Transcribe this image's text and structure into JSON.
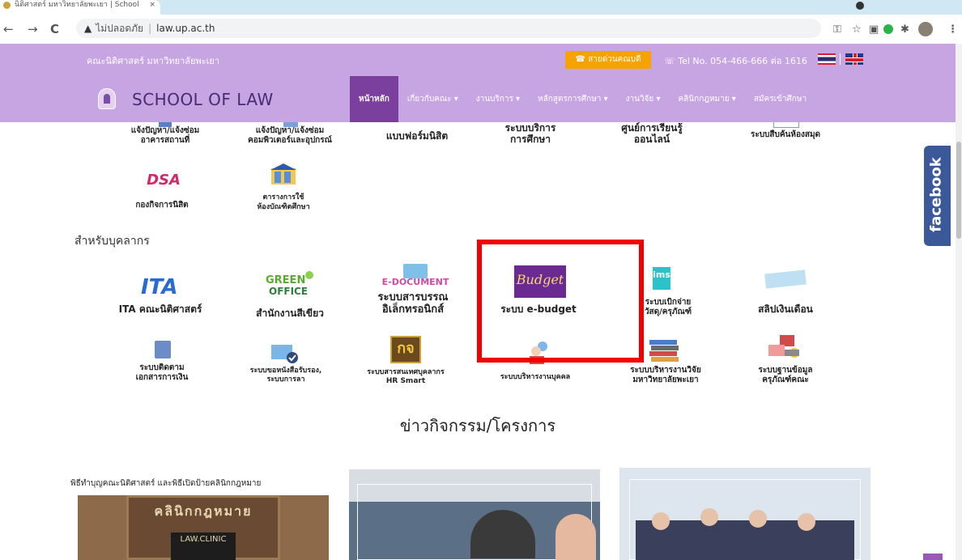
{
  "browser": {
    "tab_title": "นิติศาสตร์ มหาวิทยาลัยพะเยา | School",
    "tab_close": "×",
    "address_warning": "ไม่ปลอดภัย",
    "address_separator": "|",
    "url": "law.up.ac.th",
    "back": "←",
    "forward": "→",
    "reload": "C"
  },
  "topbar": {
    "faculty_name": "คณะนิติศาสตร์ มหาวิทยาลัยพะเยา",
    "hotline_label": "☎ สายด่วนคณบดี",
    "tel_label": "☏ Tel No. 054-466-666 ต่อ 1616"
  },
  "navbar": {
    "site_name": "SCHOOL OF LAW",
    "menu": [
      {
        "label": "หน้าหลัก"
      },
      {
        "label": "เกี่ยวกับคณะ ▾"
      },
      {
        "label": "งานบริการ ▾"
      },
      {
        "label": "หลักสูตรการศึกษา ▾"
      },
      {
        "label": "งานวิจัย ▾"
      },
      {
        "label": "คลินิกกฎหมาย ▾"
      },
      {
        "label": "สมัครเข้าศึกษา"
      }
    ]
  },
  "student_services": {
    "row1": [
      {
        "label": "แจ้งปัญหา/แจ้งซ่อม\nอาคารสถานที่"
      },
      {
        "label": "แจ้งปัญหา/แจ้งซ่อม\nคอมพิวเตอร์และอุปกรณ์"
      },
      {
        "label": "แบบฟอร์มนิสิต"
      },
      {
        "label": "ระบบบริการ\nการศึกษา"
      },
      {
        "label": "ศูนย์การเรียนรู้\nออนไลน์"
      },
      {
        "label": "ระบบสืบค้นห้องสมุด"
      }
    ],
    "row2": [
      {
        "label": "กองกิจการนิสิต",
        "icon_text": "DSA"
      },
      {
        "label": "ตารางการใช้\nห้องบัณฑิตศึกษา"
      }
    ]
  },
  "staff_section": {
    "title": "สำหรับบุคลากร",
    "row1": [
      {
        "label": "ITA คณะนิติศาสตร์",
        "icon_text": "ITA"
      },
      {
        "label": "สำนักงานสีเขียว",
        "icon_text": "GREEN OFFICE"
      },
      {
        "label": "ระบบสารบรรณ\nอิเล็กทรอนิกส์",
        "icon_text": "E-DOCUMENT"
      },
      {
        "label": "ระบบ e-budget",
        "icon_text": "Budget"
      },
      {
        "label": "ระบบเบิกจ่าย\nวัสดุ/ครุภัณฑ์",
        "icon_text": "ims"
      },
      {
        "label": "สลิปเงินเดือน"
      }
    ],
    "row2": [
      {
        "label": "ระบบติดตาม\nเอกสารการเงิน"
      },
      {
        "label": "ระบบขอหนังสือรับรอง,\nระบบการลา"
      },
      {
        "label": "ระบบสารสนเทศบุคลากร\nHR Smart",
        "icon_text": "กจ"
      },
      {
        "label": "ระบบบริหารงานบุคคล"
      },
      {
        "label": "ระบบบริหารงานวิจัย\nมหาวิทยาลัยพะเยา"
      },
      {
        "label": "ระบบฐานข้อมูล\nครุภัณฑ์คณะ"
      }
    ]
  },
  "news": {
    "title": "ข่าวกิจกรรม/โครงการ",
    "card1_caption": "พิธีทำบุญคณะนิติศาสตร์ และพิธีเปิดป้ายคลินิกกฎหมาย",
    "card1_sign": "คลินิกกฎหมาย",
    "card1_sign_en": "LAW.CLINIC"
  },
  "facebook_label": "facebook",
  "colors": {
    "header_purple": "#c7a4e2",
    "active_menu": "#7b3f9e",
    "hotline_orange": "#f6a300",
    "highlight_red": "#f20000",
    "facebook_blue": "#3b5998"
  }
}
